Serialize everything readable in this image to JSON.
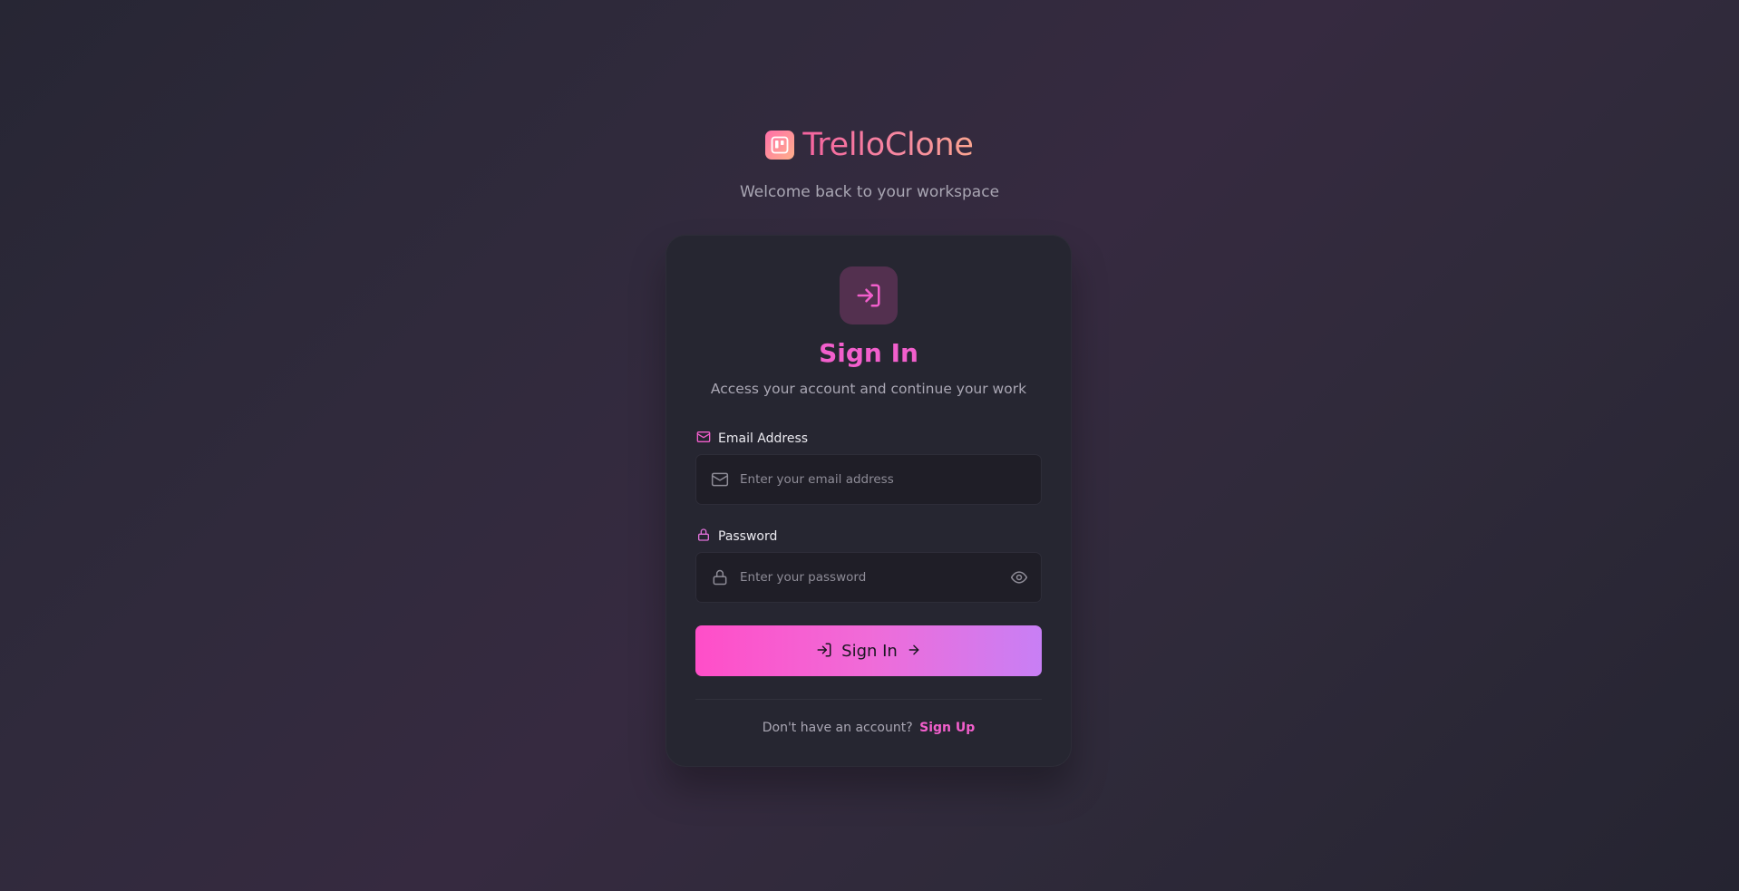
{
  "brand": {
    "name": "TrelloClone",
    "tagline": "Welcome back to your workspace"
  },
  "card": {
    "icon": "sign-in-icon",
    "title": "Sign In",
    "subtitle": "Access your account and continue your work"
  },
  "form": {
    "email": {
      "label": "Email Address",
      "value": "",
      "placeholder": "Enter your email address",
      "icon": "mail-icon"
    },
    "password": {
      "label": "Password",
      "value": "",
      "placeholder": "Enter your password",
      "icon": "lock-icon",
      "toggle_icon": "eye-icon"
    },
    "submit_label": "Sign In"
  },
  "footer": {
    "prompt": "Don't have an account?",
    "link_label": "Sign Up"
  },
  "colors": {
    "accent": "#f25fcc",
    "brand_gradient_start": "#f5639f",
    "brand_gradient_end": "#fba58f",
    "button_gradient_start": "#ff4ec8",
    "button_gradient_end": "#c87ff5",
    "card_bg": "#262631",
    "input_bg": "#1f1e27"
  }
}
